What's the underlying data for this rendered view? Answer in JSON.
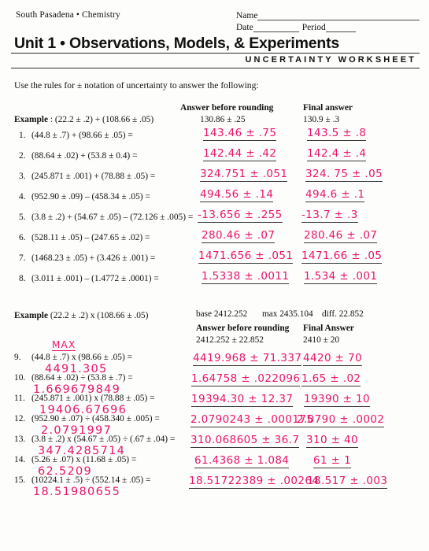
{
  "header": {
    "school_course": "South Pasadena • Chemistry",
    "name_label": "Name",
    "date_label": "Date",
    "period_label": "Period",
    "title": "Unit 1 • Observations, Models, & Experiments",
    "subtitle": "UNCERTAINTY WORKSHEET"
  },
  "instructions": "Use the rules for ± notation of uncertainty to answer  the following:",
  "columns": {
    "before_rounding": "Answer before rounding",
    "final_answer": "Final answer",
    "final_answer_caps": "Final Answer"
  },
  "example1": {
    "label_bold": "Example",
    "label_rest": " : (22.2 ± .2) + (108.66 ± .05)",
    "before": "130.86 ± .25",
    "final": "130.9 ± .3"
  },
  "example2": {
    "label_bold": "Example",
    "label_rest": " (22.2 ± .2) x (108.66 ± .05)",
    "base": "base 2412.252",
    "max": "max 2435.104",
    "diff": "diff. 22.852",
    "before": "2412.252 ± 22.852",
    "final": "2410 ± 20",
    "annotation": "MAX"
  },
  "problems_add": [
    {
      "num": "1.",
      "text": "(44.8 ± .7) + (98.66 ± .05) =",
      "before": "143.46 ± .75",
      "final": "143.5 ± .8"
    },
    {
      "num": "2.",
      "text": "(88.64 ± .02) + (53.8 ± 0.4) =",
      "before": "142.44 ± .42",
      "final": "142.4 ± .4"
    },
    {
      "num": "3.",
      "text": "(245.871 ± .001) + (78.88 ± .05) =",
      "before": "324.751 ± .051",
      "final": "324. 75 ± .05"
    },
    {
      "num": "4.",
      "text": "(952.90 ± .09) – (458.34 ± .05) =",
      "before": "494.56 ± .14",
      "final": "494.6 ± .1"
    },
    {
      "num": "5.",
      "text": "(3.8 ± .2) + (54.67 ± .05) – (72.126 ± .005) =",
      "before": "-13.656 ± .255",
      "final": "-13.7 ± .3"
    },
    {
      "num": "6.",
      "text": "(528.11 ± .05) – (247.65 ± .02) =",
      "before": "280.46 ± .07",
      "final": "280.46 ± .07"
    },
    {
      "num": "7.",
      "text": "(1468.23 ± .05) + (3.426 ± .001) =",
      "before": "1471.656 ± .051",
      "final": "1471.66 ± .05"
    },
    {
      "num": "8.",
      "text": "(3.011 ± .001) – (1.4772 ± .0001) =",
      "before": "1.5338 ± .0011",
      "final": "1.534 ± .001"
    }
  ],
  "problems_mult": [
    {
      "num": "9.",
      "text": "(44.8 ± .7) x (98.66 ± .05) =",
      "work": "4491.305",
      "before": "4419.968 ± 71.337",
      "final": "4420 ± 70"
    },
    {
      "num": "10.",
      "text": "(88.64 ± .02) ÷ (53.8 ± .7) =",
      "work": "1.669679849",
      "before": "1.64758 ± .022096",
      "final": "1.65 ± .02"
    },
    {
      "num": "11.",
      "text": "(245.871 ± .001) x (78.88 ± .05) =",
      "work": "19406.67696",
      "before": "19394.30 ± 12.37",
      "final": "19390 ± 10"
    },
    {
      "num": "12.",
      "text": "(952.90 ± .07) ÷ (458.340 ± .005) =",
      "work": "2.0791997",
      "before": "2.0790243 ± .000175",
      "final": "2.0790 ± .0002"
    },
    {
      "num": "13.",
      "text": "(3.8 ± .2) x (54.67 ± .05) ÷ (.67 ± .04) =",
      "work": "347.4285714",
      "before": "310.068605 ± 36.7",
      "final": "310 ± 40"
    },
    {
      "num": "14.",
      "text": "(5.26 ± .07) x (11.68 ± .05) =",
      "work": "62.5209",
      "before": "61.4368 ± 1.084",
      "final": "61 ± 1"
    },
    {
      "num": "15.",
      "text": "(10224.1 ± .5) ÷ (552.14 ± .05) =",
      "work": "18.51980655",
      "before": "18.51722389 ± .00264",
      "final": "18.517 ± .003"
    }
  ],
  "colors": {
    "ink": "#e8146b",
    "print": "#111111",
    "rule": "#3a3a3a"
  }
}
